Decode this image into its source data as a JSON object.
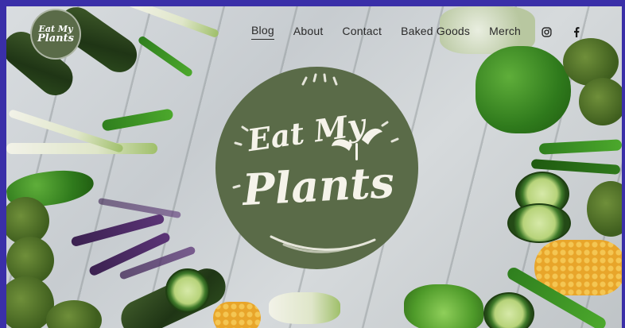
{
  "site": {
    "logo_small": {
      "line1": "Eat My",
      "line2": "Plants"
    },
    "logo_hero": {
      "line1": "Eat My",
      "line2": "Plants"
    }
  },
  "nav": {
    "items": [
      {
        "label": "Blog",
        "active": true
      },
      {
        "label": "About",
        "active": false
      },
      {
        "label": "Contact",
        "active": false
      },
      {
        "label": "Baked Goods",
        "active": false
      },
      {
        "label": "Merch",
        "active": false
      }
    ],
    "social": [
      {
        "icon": "instagram-icon"
      },
      {
        "icon": "facebook-icon"
      }
    ]
  },
  "colors": {
    "page_border": "#3a2fa8",
    "logo_green": "#5a6b48",
    "nav_text": "#2a2a2a",
    "logo_text": "#f5f3ea"
  }
}
